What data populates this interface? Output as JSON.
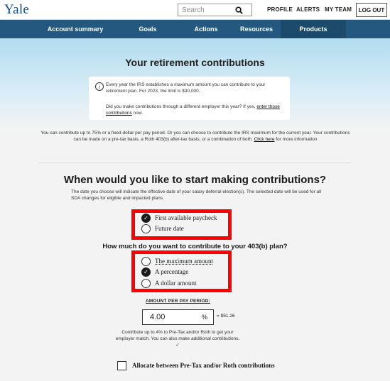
{
  "header": {
    "logo": "Yale",
    "search_placeholder": "Search",
    "links": [
      "PROFILE",
      "ALERTS",
      "MY TEAM"
    ],
    "logout": "LOG OUT"
  },
  "nav": {
    "items": [
      "Account summary",
      "Goals",
      "Actions",
      "Resources",
      "Products"
    ],
    "active": "Resources"
  },
  "hero": {
    "title": "Your retirement contributions"
  },
  "info": {
    "p1": "Every year the IRS establishes a maximum amount you can contribute to your retirement plan. For 2023, the limit is $30,000.",
    "p2_prefix": "Did you make contributions through a different employer this year? If yes, ",
    "p2_link": "enter those contributions",
    "p2_suffix": " now."
  },
  "intro": {
    "text": "You can contribute up to 75% or a fixed dollar per pay period. Or you can choose to contribute the IRS maximum for the current year. Your contributions can be made on a pre-tax basis, a Roth 403(b) after-tax basis, or a combination of both. ",
    "link": "Click here",
    "suffix": " for more information"
  },
  "q1": {
    "title": "When would you like to start making contributions?",
    "desc": "The date you choose will indicate the effective date of your salary deferral election(s). The selected date will be used for all SDA changes for eligible and impacted plans.",
    "options": [
      {
        "label": "First available paycheck",
        "selected": true
      },
      {
        "label": "Future date",
        "selected": false
      }
    ]
  },
  "q2": {
    "title": "How much do you want to contribute to your 403(b) plan?",
    "options": [
      {
        "label": "The maximum amount",
        "selected": false
      },
      {
        "label": "A percentage",
        "selected": true
      },
      {
        "label": "A dollar amount",
        "selected": false
      }
    ]
  },
  "amount": {
    "label": "AMOUNT PER PAY PERIOD:",
    "value": "4.00",
    "unit": "%",
    "equals": "= $51.26",
    "note": "Contribute up to 4% to Pre-Tax and/or Roth to get your employer match. You can also make additional contributions. ✓"
  },
  "allocate": {
    "label": "Allocate between Pre-Tax and/or Roth contributions",
    "checked": false
  },
  "colors": {
    "nav_bg": "#25587e",
    "highlight": "#ff0000",
    "logo": "#0f4d92"
  }
}
